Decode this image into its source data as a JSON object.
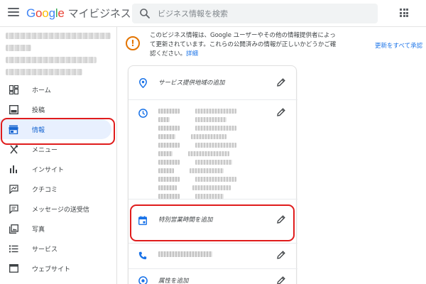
{
  "header": {
    "logo_letters": [
      "G",
      "o",
      "o",
      "g",
      "l",
      "e"
    ],
    "product": "マイビジネス",
    "search_placeholder": "ビジネス情報を検索"
  },
  "sidebar": {
    "items": [
      {
        "label": "ホーム",
        "icon": "dashboard-icon"
      },
      {
        "label": "投稿",
        "icon": "post-icon"
      },
      {
        "label": "情報",
        "icon": "storefront-icon"
      },
      {
        "label": "メニュー",
        "icon": "restaurant-icon"
      },
      {
        "label": "インサイト",
        "icon": "insights-icon"
      },
      {
        "label": "クチコミ",
        "icon": "reviews-icon"
      },
      {
        "label": "メッセージの送受信",
        "icon": "message-icon"
      },
      {
        "label": "写真",
        "icon": "photos-icon"
      },
      {
        "label": "サービス",
        "icon": "list-icon"
      },
      {
        "label": "ウェブサイト",
        "icon": "website-icon"
      }
    ],
    "active_index": 2
  },
  "banner": {
    "line1": "このビジネス情報は、Google ユーザーやその他の情報提供者によっ",
    "line2": "て更新されています。これらの公開済みの情報が正しいかどうかご確",
    "line3": "認ください。",
    "details_link": "詳細",
    "approve_all": "更新をすべて承認"
  },
  "card": {
    "service_area": "サービス提供地域の追加",
    "special_hours": "特別営業時間を追加",
    "attributes": "属性を追加"
  },
  "colors": {
    "accent": "#1a73e8",
    "active_bg": "#e8f0fe",
    "warning": "#e37400",
    "highlight": "#e01c1c"
  }
}
